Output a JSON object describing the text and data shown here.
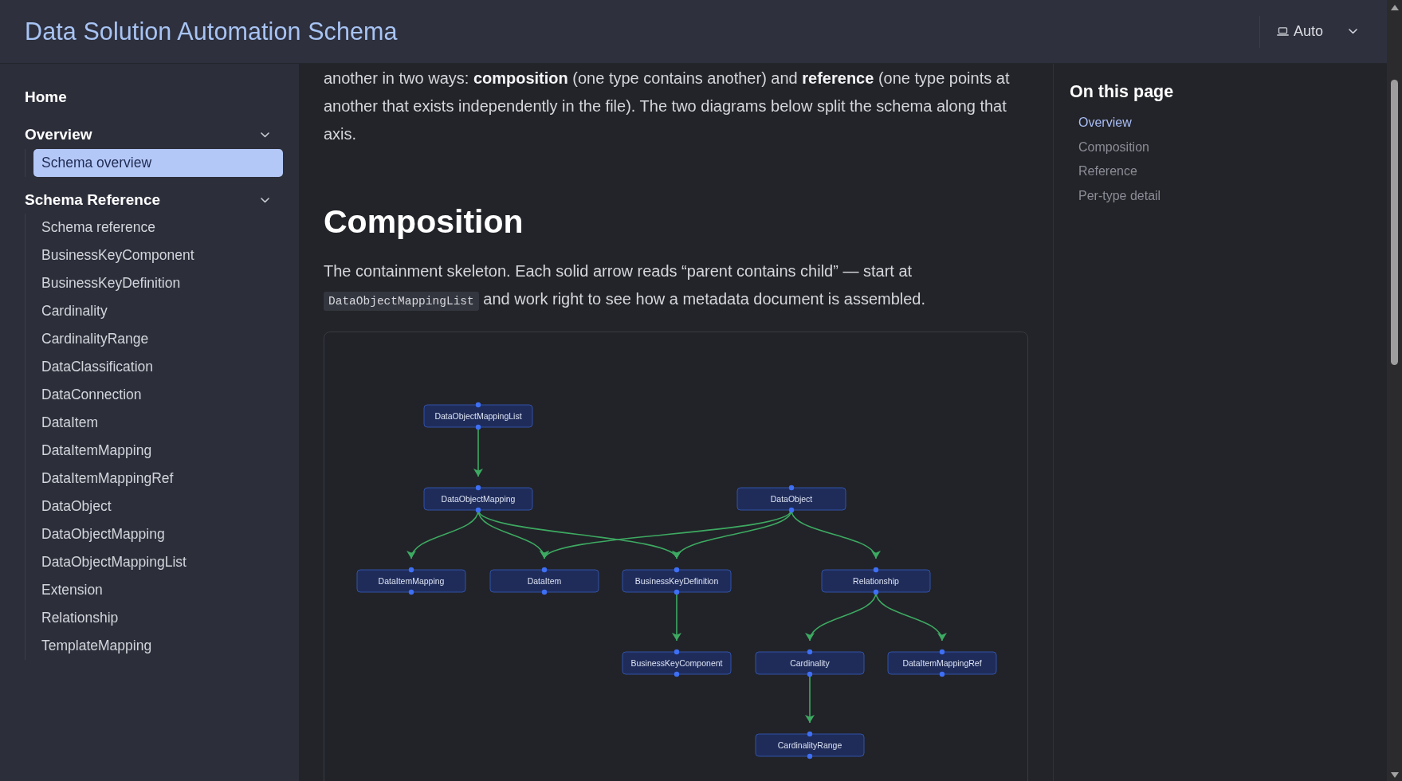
{
  "header": {
    "title": "Data Solution Automation Schema",
    "theme": {
      "value": "Auto"
    }
  },
  "sidebar": {
    "items": [
      {
        "kind": "link",
        "label": "Home",
        "selected": false
      },
      {
        "kind": "section",
        "label": "Overview",
        "expanded": true,
        "children": [
          {
            "label": "Schema overview",
            "selected": true
          }
        ]
      },
      {
        "kind": "section",
        "label": "Schema Reference",
        "expanded": true,
        "children": [
          {
            "label": "Schema reference",
            "selected": false
          },
          {
            "label": "BusinessKeyComponent",
            "selected": false
          },
          {
            "label": "BusinessKeyDefinition",
            "selected": false
          },
          {
            "label": "Cardinality",
            "selected": false
          },
          {
            "label": "CardinalityRange",
            "selected": false
          },
          {
            "label": "DataClassification",
            "selected": false
          },
          {
            "label": "DataConnection",
            "selected": false
          },
          {
            "label": "DataItem",
            "selected": false
          },
          {
            "label": "DataItemMapping",
            "selected": false
          },
          {
            "label": "DataItemMappingRef",
            "selected": false
          },
          {
            "label": "DataObject",
            "selected": false
          },
          {
            "label": "DataObjectMapping",
            "selected": false
          },
          {
            "label": "DataObjectMappingList",
            "selected": false
          },
          {
            "label": "Extension",
            "selected": false
          },
          {
            "label": "Relationship",
            "selected": false
          },
          {
            "label": "TemplateMapping",
            "selected": false
          }
        ]
      }
    ]
  },
  "content": {
    "intro": "another in two ways: **composition** (one type contains another) and **reference** (one type points at another that exists independently in the file). The two diagrams below split the schema along that axis.",
    "heading": "Composition",
    "paragraph": {
      "text_before": "The containment skeleton. Each solid arrow reads “parent contains child” — start at",
      "code": "DataObjectMappingList",
      "text_after": "and work right to see how a metadata document is assembled."
    },
    "diagram": {
      "nodes": [
        {
          "label": "DataObjectMappingList"
        },
        {
          "label": "DataObjectMapping"
        },
        {
          "label": "DataObject"
        },
        {
          "label": "DataItemMapping"
        },
        {
          "label": "DataItem"
        },
        {
          "label": "BusinessKeyDefinition"
        },
        {
          "label": "Relationship"
        },
        {
          "label": "BusinessKeyComponent"
        },
        {
          "label": "Cardinality"
        },
        {
          "label": "DataItemMappingRef"
        },
        {
          "label": "CardinalityRange"
        }
      ]
    }
  },
  "toc": {
    "title": "On this page",
    "items": [
      {
        "label": "Overview",
        "selected": true
      },
      {
        "label": "Composition",
        "selected": false
      },
      {
        "label": "Reference",
        "selected": false
      },
      {
        "label": "Per-type detail",
        "selected": false
      }
    ]
  }
}
